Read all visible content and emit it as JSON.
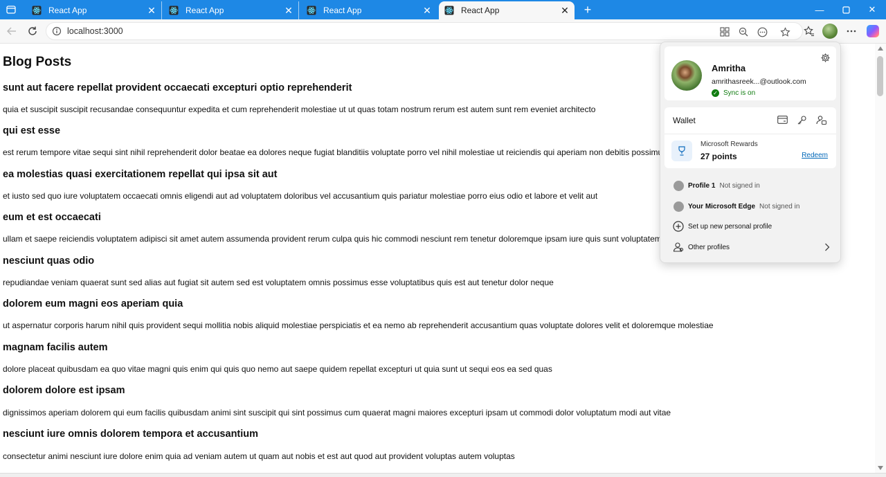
{
  "browser": {
    "tabs": [
      {
        "title": "React App",
        "active": false
      },
      {
        "title": "React App",
        "active": false
      },
      {
        "title": "React App",
        "active": false
      },
      {
        "title": "React App",
        "active": true
      }
    ],
    "address": "localhost:3000",
    "colors": {
      "tabstrip": "#1e88e5",
      "sync": "#107c10",
      "link": "#0067b8"
    }
  },
  "page": {
    "title": "Blog Posts",
    "posts": [
      {
        "title": "sunt aut facere repellat provident occaecati excepturi optio reprehenderit",
        "body": "quia et suscipit suscipit recusandae consequuntur expedita et cum reprehenderit molestiae ut ut quas totam nostrum rerum est autem sunt rem eveniet architecto"
      },
      {
        "title": "qui est esse",
        "body": "est rerum tempore vitae sequi sint nihil reprehenderit dolor beatae ea dolores neque fugiat blanditiis voluptate porro vel nihil molestiae ut reiciendis qui aperiam non debitis possimus qui neque nisi nulla"
      },
      {
        "title": "ea molestias quasi exercitationem repellat qui ipsa sit aut",
        "body": "et iusto sed quo iure voluptatem occaecati omnis eligendi aut ad voluptatem doloribus vel accusantium quis pariatur molestiae porro eius odio et labore et velit aut"
      },
      {
        "title": "eum et est occaecati",
        "body": "ullam et saepe reiciendis voluptatem adipisci sit amet autem assumenda provident rerum culpa quis hic commodi nesciunt rem tenetur doloremque ipsam iure quis sunt voluptatem rerum illo velit"
      },
      {
        "title": "nesciunt quas odio",
        "body": "repudiandae veniam quaerat sunt sed alias aut fugiat sit autem sed est voluptatem omnis possimus esse voluptatibus quis est aut tenetur dolor neque"
      },
      {
        "title": "dolorem eum magni eos aperiam quia",
        "body": "ut aspernatur corporis harum nihil quis provident sequi mollitia nobis aliquid molestiae perspiciatis et ea nemo ab reprehenderit accusantium quas voluptate dolores velit et doloremque molestiae"
      },
      {
        "title": "magnam facilis autem",
        "body": "dolore placeat quibusdam ea quo vitae magni quis enim qui quis quo nemo aut saepe quidem repellat excepturi ut quia sunt ut sequi eos ea sed quas"
      },
      {
        "title": "dolorem dolore est ipsam",
        "body": "dignissimos aperiam dolorem qui eum facilis quibusdam animi sint suscipit qui sint possimus cum quaerat magni maiores excepturi ipsam ut commodi dolor voluptatum modi aut vitae"
      },
      {
        "title": "nesciunt iure omnis dolorem tempora et accusantium",
        "body": "consectetur animi nesciunt iure dolore enim quia ad veniam autem ut quam aut nobis et est aut quod aut provident voluptas autem voluptas"
      }
    ]
  },
  "profile_menu": {
    "name": "Amritha",
    "email": "amrithasreek...@outlook.com",
    "sync": "Sync is on",
    "wallet": "Wallet",
    "rewards_label": "Microsoft Rewards",
    "rewards_points": "27 points",
    "redeem": "Redeem",
    "profiles": [
      {
        "name": "Profile 1",
        "status": "Not signed in"
      },
      {
        "name": "Your Microsoft Edge",
        "status": "Not signed in"
      }
    ],
    "setup_profile": "Set up new personal profile",
    "other_profiles": "Other profiles"
  }
}
